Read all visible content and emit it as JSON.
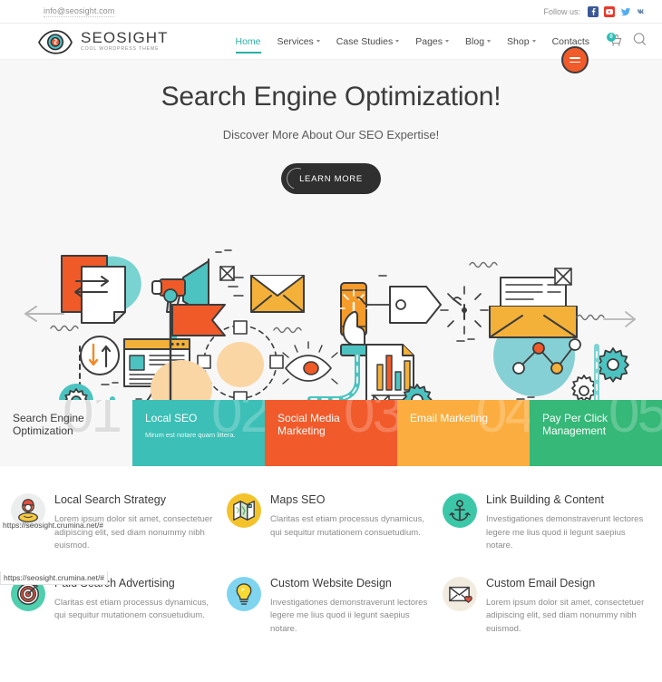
{
  "topbar": {
    "email": "info@seosight.com",
    "follow_label": "Follow us:",
    "social": [
      {
        "name": "facebook-icon",
        "glyph": "f",
        "color": "#3b5998"
      },
      {
        "name": "youtube-icon",
        "glyph": "▶",
        "color": "#e8392a"
      },
      {
        "name": "twitter-icon",
        "glyph": "t",
        "color": "#55acee"
      },
      {
        "name": "vk-icon",
        "glyph": "vk",
        "color": "#5b7fa6"
      }
    ]
  },
  "header": {
    "logo_title": "SEOSIGHT",
    "logo_subtitle": "COOL WORDPRESS THEME",
    "nav": [
      {
        "label": "Home",
        "active": true,
        "dropdown": false
      },
      {
        "label": "Services",
        "active": false,
        "dropdown": true
      },
      {
        "label": "Case Studies",
        "active": false,
        "dropdown": true
      },
      {
        "label": "Pages",
        "active": false,
        "dropdown": true
      },
      {
        "label": "Blog",
        "active": false,
        "dropdown": true
      },
      {
        "label": "Shop",
        "active": false,
        "dropdown": true
      },
      {
        "label": "Contacts",
        "active": false,
        "dropdown": false
      }
    ],
    "cart_count": "0",
    "accent_color": "#29b0a5"
  },
  "hero": {
    "title": "Search Engine Optimization!",
    "subtitle": "Discover More About Our SEO Expertise!",
    "button_label": "LEARN MORE"
  },
  "tiles": [
    {
      "number": "01",
      "title": "Search Engine Optimization",
      "subtitle": "",
      "color": "#f7f7f7"
    },
    {
      "number": "02",
      "title": "Local SEO",
      "subtitle": "Mirum est notare quam littera.",
      "color": "#3cbfb6"
    },
    {
      "number": "03",
      "title": "Social Media Marketing",
      "subtitle": "",
      "color": "#f15a2b"
    },
    {
      "number": "04",
      "title": "Email Marketing",
      "subtitle": "",
      "color": "#fbad3f"
    },
    {
      "number": "05",
      "title": "Pay Per Click Management",
      "subtitle": "",
      "color": "#35b878"
    }
  ],
  "features": [
    {
      "icon": "avatar-person-icon",
      "icon_bg": "#eceded",
      "title": "Local Search Strategy",
      "text": "Lorem ipsum dolor sit amet, consectetuer adipiscing elit, sed diam nonummy nibh euismod."
    },
    {
      "icon": "map-icon",
      "icon_bg": "#f4c32c",
      "title": "Maps SEO",
      "text": "Claritas est etiam processus dynamicus, qui sequitur mutationem consuetudium."
    },
    {
      "icon": "anchor-icon",
      "icon_bg": "#3cc8a8",
      "title": "Link Building & Content",
      "text": "Investigationes demonstraverunt lectores legere me lius quod ii legunt saepius notare."
    },
    {
      "icon": "target-dartboard-icon",
      "icon_bg": "#4ecfae",
      "title": "Paid Search Advertising",
      "text": "Claritas est etiam processus dynamicus, qui sequitur mutationem consuetudium."
    },
    {
      "icon": "lightbulb-icon",
      "icon_bg": "#7fd4ef",
      "title": "Custom Website Design",
      "text": "Investigationes demonstraverunt lectores legere me lius quod ii legunt saepius notare."
    },
    {
      "icon": "envelope-heart-icon",
      "icon_bg": "#f2ece0",
      "title": "Custom Email Design",
      "text": "Lorem ipsum dolor sit amet, consectetuer adipiscing elit, sed diam nonummy nibh euismod."
    }
  ],
  "status_urls": [
    "https://seosight.crumina.net/#",
    "https://seosight.crumina.net/#"
  ]
}
